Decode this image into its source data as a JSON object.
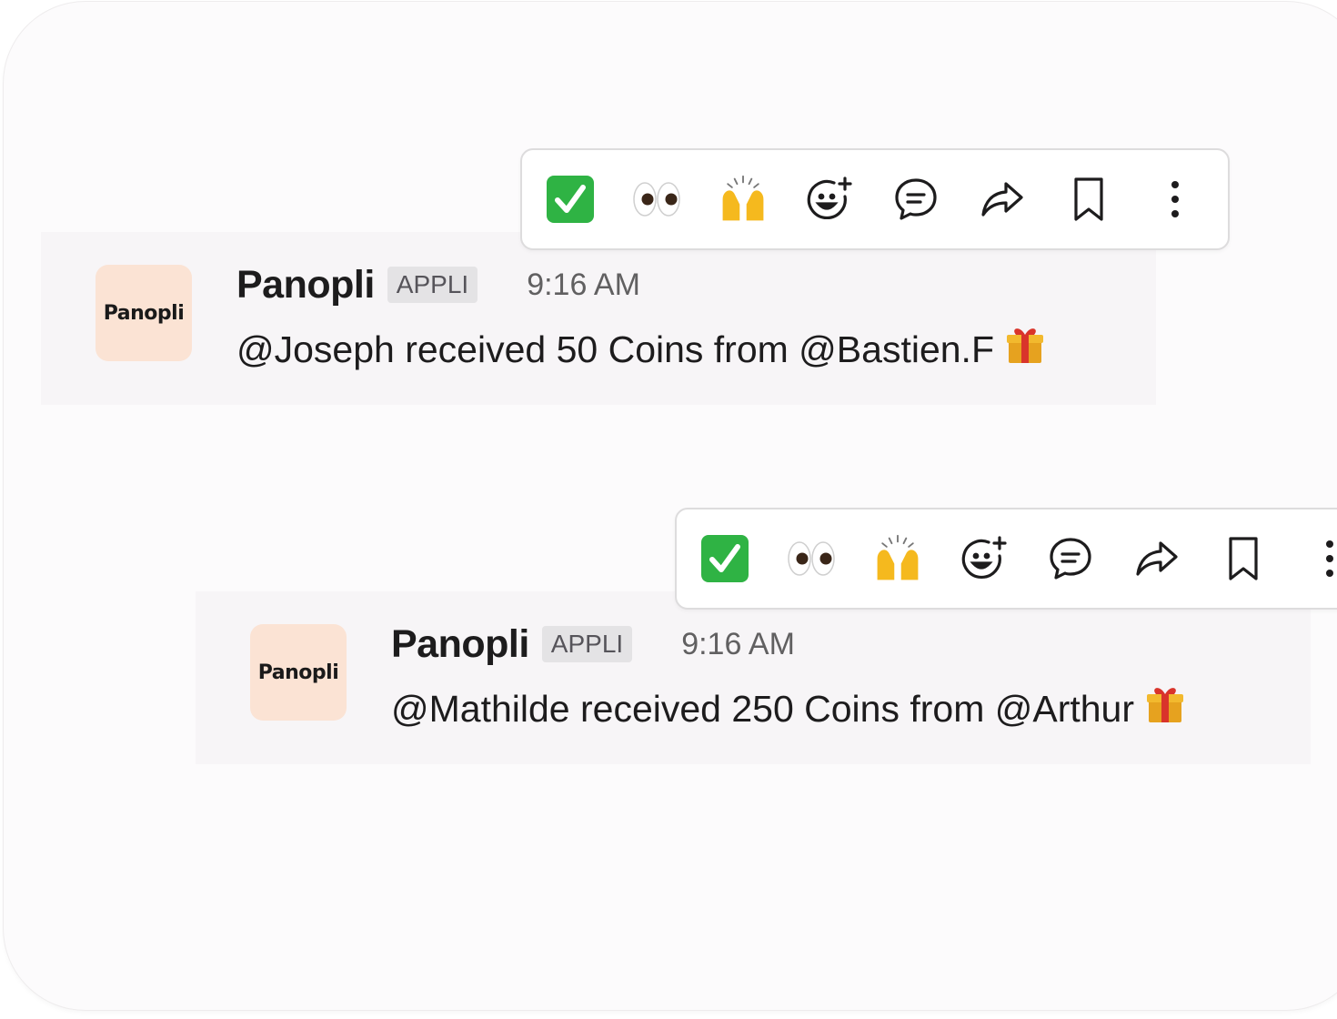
{
  "messages": [
    {
      "avatar_text": "Panopli",
      "sender": "Panopli",
      "badge": "APPLI",
      "time": "9:16 AM",
      "text": "@Joseph received 50 Coins from @Bastien.F"
    },
    {
      "avatar_text": "Panopli",
      "sender": "Panopli",
      "badge": "APPLI",
      "time": "9:16 AM",
      "text": "@Mathilde received 250 Coins from @Arthur"
    }
  ],
  "toolbar_icons": [
    "check-mark-emoji-icon",
    "eyes-emoji-icon",
    "raised-hands-emoji-icon",
    "add-reaction-icon",
    "reply-thread-icon",
    "share-icon",
    "bookmark-icon",
    "more-actions-icon"
  ],
  "colors": {
    "avatar_bg": "#fbe3d4",
    "badge_bg": "#e4e3e5",
    "message_hover_bg": "#f7f5f7",
    "check_green": "#2fb344"
  }
}
